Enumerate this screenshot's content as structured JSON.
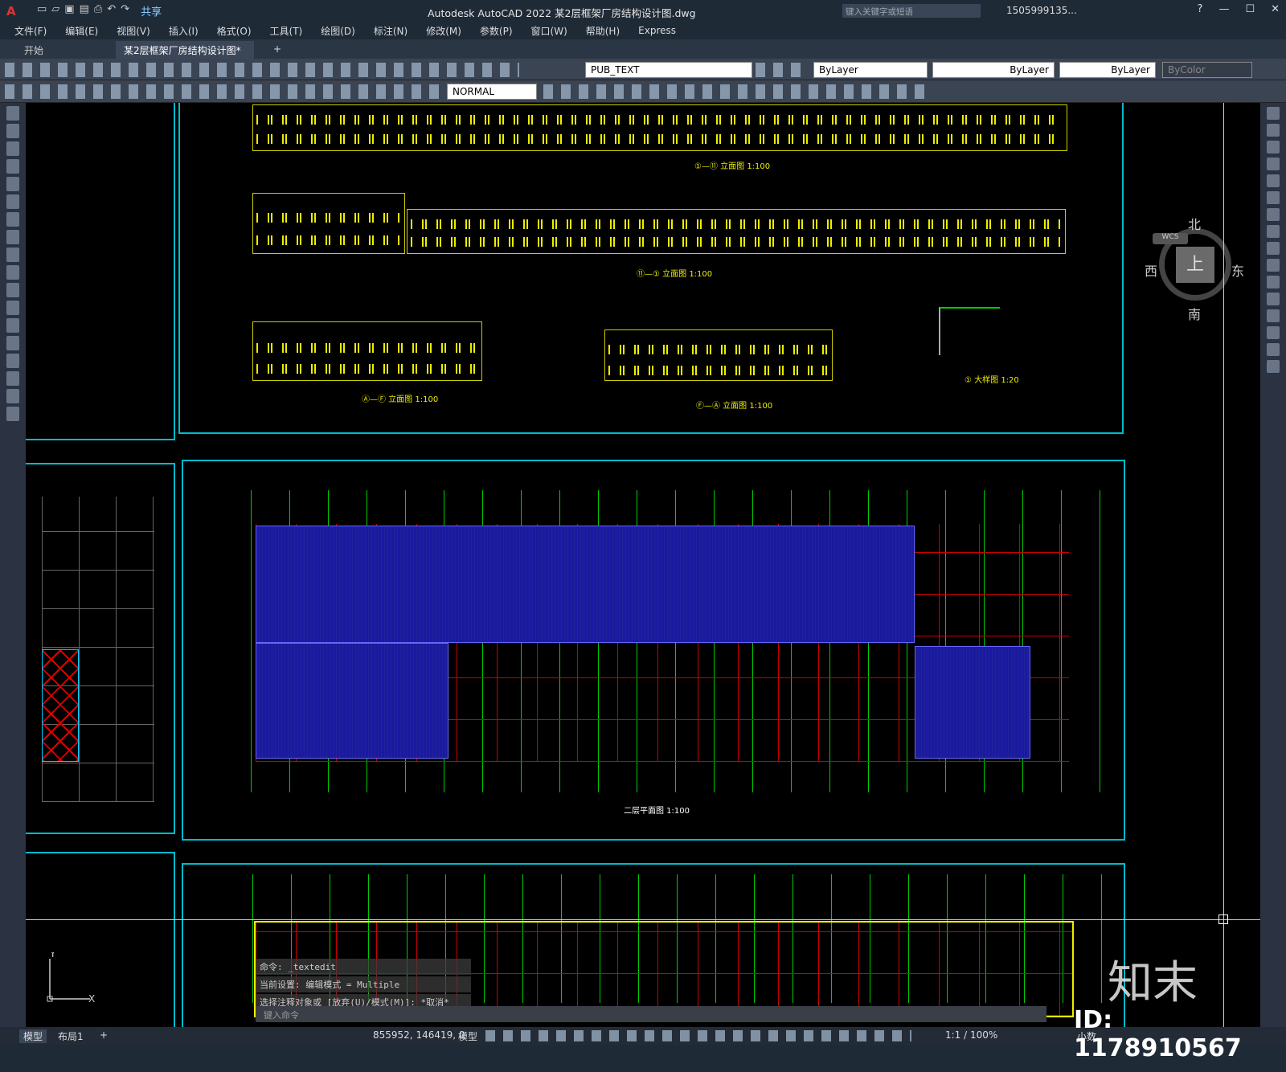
{
  "app": {
    "title": "Autodesk AutoCAD 2022    某2层框架厂房结构设计图.dwg",
    "logo": "A",
    "share": "共享",
    "search_placeholder": "键入关键字或短语",
    "user": "1505999135...",
    "help": "?"
  },
  "menu": [
    "文件(F)",
    "编辑(E)",
    "视图(V)",
    "插入(I)",
    "格式(O)",
    "工具(T)",
    "绘图(D)",
    "标注(N)",
    "修改(M)",
    "参数(P)",
    "窗口(W)",
    "帮助(H)",
    "Express"
  ],
  "tabs": {
    "start": "开始",
    "doc": "某2层框架厂房结构设计图*",
    "close": "×",
    "add": "+"
  },
  "toolbar": {
    "layer": "PUB_TEXT",
    "color": "ByLayer",
    "linetype": "ByLayer",
    "lineweight": "ByLayer",
    "plotstyle": "ByColor",
    "textstyle": "NORMAL"
  },
  "viewcube": {
    "north": "北",
    "south": "南",
    "west": "西",
    "east": "东",
    "top": "上",
    "wcs": "WCS"
  },
  "drawing": {
    "elev1": "①—⑪ 立面图 1:100",
    "elev2": "⑪—① 立面图 1:100",
    "elev3": "Ⓐ—Ⓕ 立面图 1:100",
    "elev4": "Ⓕ—Ⓐ 立面图 1:100",
    "detail": "① 大样图 1:20",
    "plan": "二层平面图   1:100"
  },
  "command": {
    "line1": "命令: _textedit",
    "line2": "当前设置: 编辑模式 = Multiple",
    "line3": "选择注释对象或 [放弃(U)/模式(M)]: *取消*",
    "input_placeholder": "键入命令"
  },
  "status": {
    "model": "模型",
    "layout1": "布局1",
    "add": "+",
    "coords": "855952, 146419, 0",
    "mode": "模型",
    "scale": "1:1 / 100%",
    "units": "小数"
  },
  "watermark": {
    "brand": "知末",
    "id": "ID: 1178910567"
  }
}
